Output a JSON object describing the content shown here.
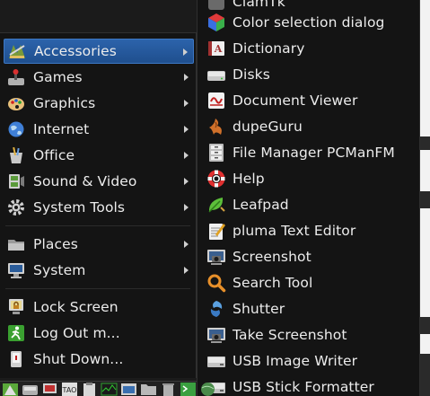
{
  "main_menu": {
    "items": [
      {
        "label": "Accessories",
        "icon": "accessories-icon",
        "has_submenu": true,
        "selected": true
      },
      {
        "label": "Games",
        "icon": "games-icon",
        "has_submenu": true
      },
      {
        "label": "Graphics",
        "icon": "graphics-icon",
        "has_submenu": true
      },
      {
        "label": "Internet",
        "icon": "internet-icon",
        "has_submenu": true
      },
      {
        "label": "Office",
        "icon": "office-icon",
        "has_submenu": true
      },
      {
        "label": "Sound & Video",
        "icon": "sound-video-icon",
        "has_submenu": true
      },
      {
        "label": "System Tools",
        "icon": "system-tools-icon",
        "has_submenu": true
      },
      {
        "label": "Places",
        "icon": "places-icon",
        "has_submenu": true
      },
      {
        "label": "System",
        "icon": "system-icon",
        "has_submenu": true
      },
      {
        "label": "Lock Screen",
        "icon": "lock-screen-icon",
        "has_submenu": false
      },
      {
        "label": "Log Out m...",
        "icon": "log-out-icon",
        "has_submenu": false
      },
      {
        "label": "Shut Down...",
        "icon": "shut-down-icon",
        "has_submenu": false
      }
    ]
  },
  "submenu": {
    "title": "Accessories",
    "partial_top_label": "ClamTk",
    "items": [
      {
        "label": "Color selection dialog",
        "icon": "color-selection-icon"
      },
      {
        "label": "Dictionary",
        "icon": "dictionary-icon"
      },
      {
        "label": "Disks",
        "icon": "disks-icon"
      },
      {
        "label": "Document Viewer",
        "icon": "document-viewer-icon"
      },
      {
        "label": "dupeGuru",
        "icon": "dupeguru-icon"
      },
      {
        "label": "File Manager PCManFM",
        "icon": "file-manager-icon"
      },
      {
        "label": "Help",
        "icon": "help-icon"
      },
      {
        "label": "Leafpad",
        "icon": "leafpad-icon"
      },
      {
        "label": "pluma Text Editor",
        "icon": "pluma-icon"
      },
      {
        "label": "Screenshot",
        "icon": "screenshot-icon"
      },
      {
        "label": "Search Tool",
        "icon": "search-tool-icon"
      },
      {
        "label": "Shutter",
        "icon": "shutter-icon"
      },
      {
        "label": "Take Screenshot",
        "icon": "take-screenshot-icon"
      },
      {
        "label": "USB Image Writer",
        "icon": "usb-image-writer-icon"
      },
      {
        "label": "USB Stick Formatter",
        "icon": "usb-stick-formatter-icon"
      }
    ]
  },
  "taskbar": {
    "icons": [
      "menu-icon",
      "drive-icon",
      "network-icon",
      "task-manager-icon",
      "clipboard-icon",
      "monitor-icon",
      "window-icon",
      "folder-icon",
      "trash-icon",
      "terminal-icon",
      "globe-icon"
    ]
  },
  "colors": {
    "menu_background": "#141414",
    "selection": "#2c63ab",
    "text": "#ececec"
  }
}
